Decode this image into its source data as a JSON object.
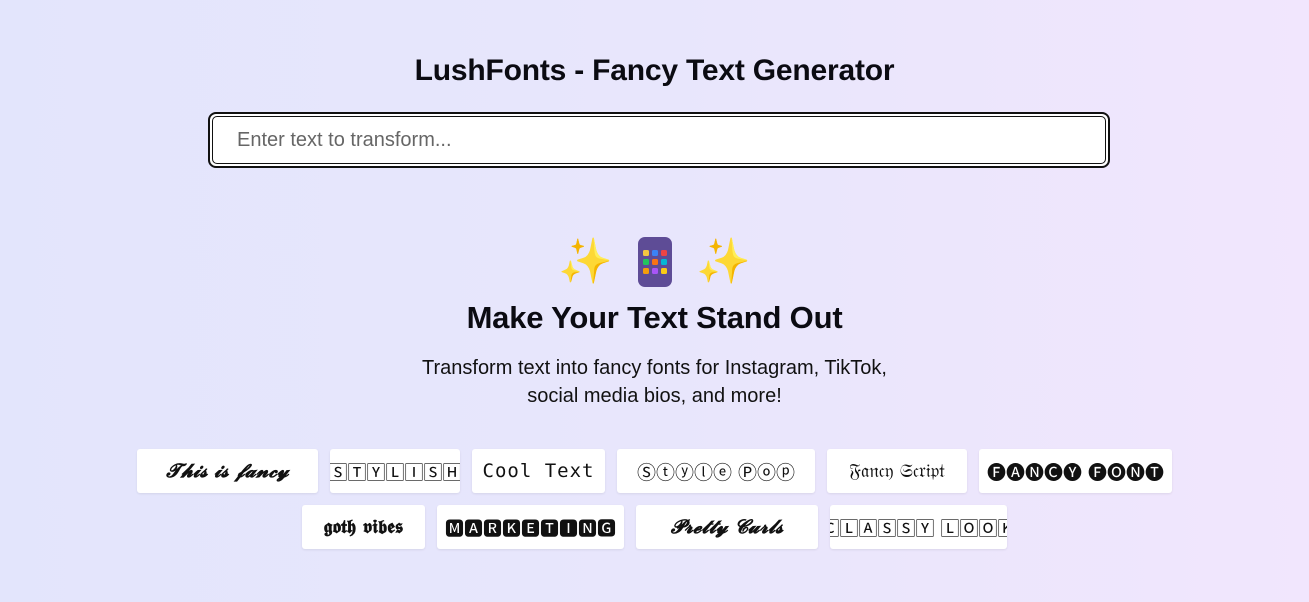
{
  "header": {
    "title": "LushFonts - Fancy Text Generator"
  },
  "search": {
    "placeholder": "Enter text to transform..."
  },
  "hero": {
    "icons": [
      "sparkles-icon",
      "mobile-phone-icon",
      "sparkles-icon"
    ],
    "sparkle_glyph": "✨",
    "headline": "Make Your Text Stand Out",
    "subtitle_line1": "Transform text into fancy fonts for Instagram, TikTok,",
    "subtitle_line2": "social media bios, and more!"
  },
  "examples": {
    "row1": [
      "𝓣𝓱𝓲𝓼 𝓲𝓼 𝓯𝓪𝓷𝓬𝔂",
      "🅂🅃🅈🄻🄸🅂🄷",
      "𝙲𝚘𝚘𝚕 𝚃𝚎𝚡𝚝",
      "Ⓢⓣⓨⓛⓔ Ⓟⓞⓟ",
      "𝔉𝔞𝔫𝔠𝔶 𝔖𝔠𝔯𝔦𝔭𝔱",
      "🅕🅐🅝🅒🅨 🅕🅞🅝🅣"
    ],
    "row2": [
      "𝖌𝖔𝖙𝖍 𝖛𝖎𝖇𝖊𝖘",
      "🅼🅰🆁🅺🅴🆃🅸🅽🅶",
      "𝓟𝓻𝓮𝓽𝓽𝔂 𝓒𝓾𝓻𝓵𝓼",
      "🄲🄻🄰🅂🅂🅈 🄻🄾🄾🄺"
    ]
  },
  "colors": {
    "background_start": "#e3e5fc",
    "background_end": "#f1e6fd",
    "sparkle": "#f6c22b",
    "phone_body": "#5e4c96",
    "app_tiles": [
      "#f4c542",
      "#3b82f6",
      "#ef4444",
      "#22c55e",
      "#f97316",
      "#06b6d4",
      "#f59e0b",
      "#a855f7",
      "#facc15"
    ]
  }
}
